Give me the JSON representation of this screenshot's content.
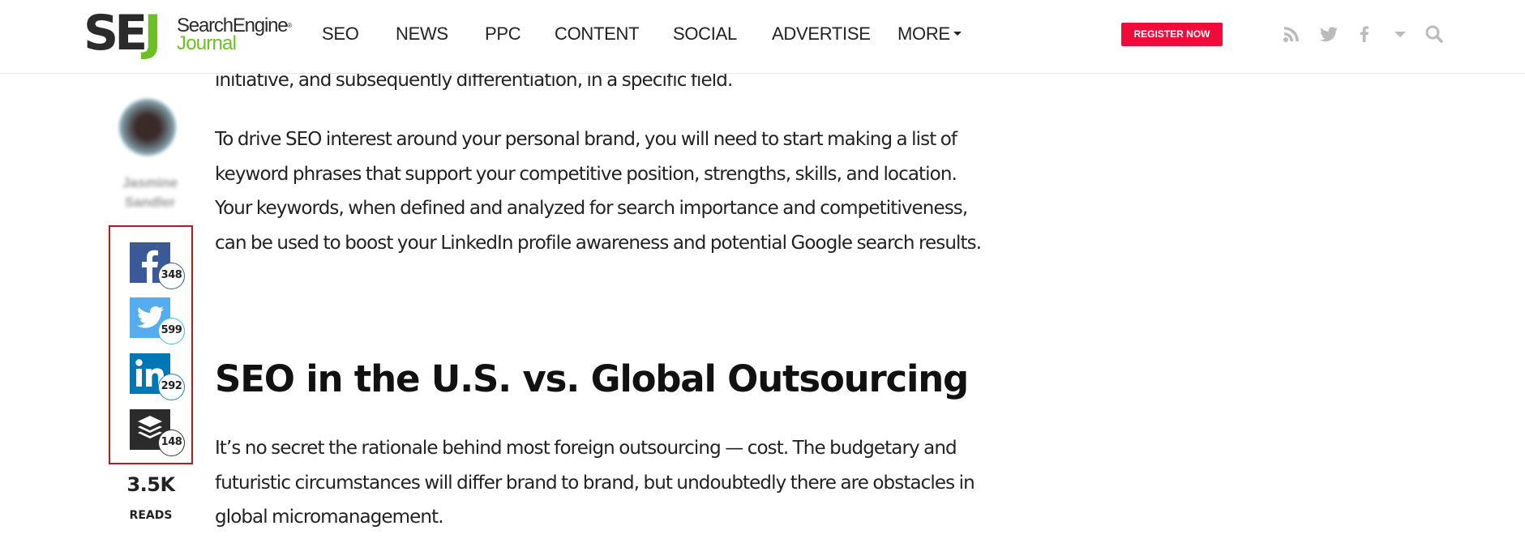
{
  "header": {
    "logo": {
      "mark_se": "SE",
      "mark_j": "J",
      "line1": "SearchEngine",
      "registered": "®",
      "line2": "Journal"
    },
    "nav": [
      {
        "label": "SEO"
      },
      {
        "label": "NEWS"
      },
      {
        "label": "PPC"
      },
      {
        "label": "CONTENT"
      },
      {
        "label": "SOCIAL"
      },
      {
        "label": "ADVERTISE"
      },
      {
        "label": "MORE",
        "has_dropdown": true
      }
    ],
    "cta_label": "REGISTER NOW",
    "cta_color": "#f10b3a",
    "icons": [
      "rss-icon",
      "twitter-icon",
      "facebook-icon",
      "chevron-down-icon",
      "search-icon"
    ],
    "icon_color": "#bbbbbb"
  },
  "sidebar": {
    "author_name": "Jasmine Sandler",
    "share": [
      {
        "network": "facebook",
        "count": "348",
        "color": "#3b5998"
      },
      {
        "network": "twitter",
        "count": "599",
        "color": "#55acee"
      },
      {
        "network": "linkedin",
        "count": "292",
        "color": "#0077b5"
      },
      {
        "network": "buffer",
        "count": "148",
        "color": "#2b2b2b"
      }
    ],
    "highlight_color": "#b41d1d",
    "reads_count": "3.5K",
    "reads_label": "READS"
  },
  "article": {
    "partial_top": "initiative, and subsequently differentiation, in a specific field.",
    "paragraph1": "To drive SEO interest around your personal brand, you will need to start making a list of keyword phrases that support your competitive position, strengths, skills, and location. Your keywords, when defined and analyzed for search importance and competitiveness, can be used to boost your LinkedIn profile awareness and potential Google search results.",
    "heading": "SEO in the U.S. vs. Global Outsourcing",
    "paragraph2": "It’s no secret the rationale behind most foreign outsourcing — cost. The budgetary and futuristic circumstances will differ brand to brand, but undoubtedly there are obstacles in global micromanagement."
  }
}
